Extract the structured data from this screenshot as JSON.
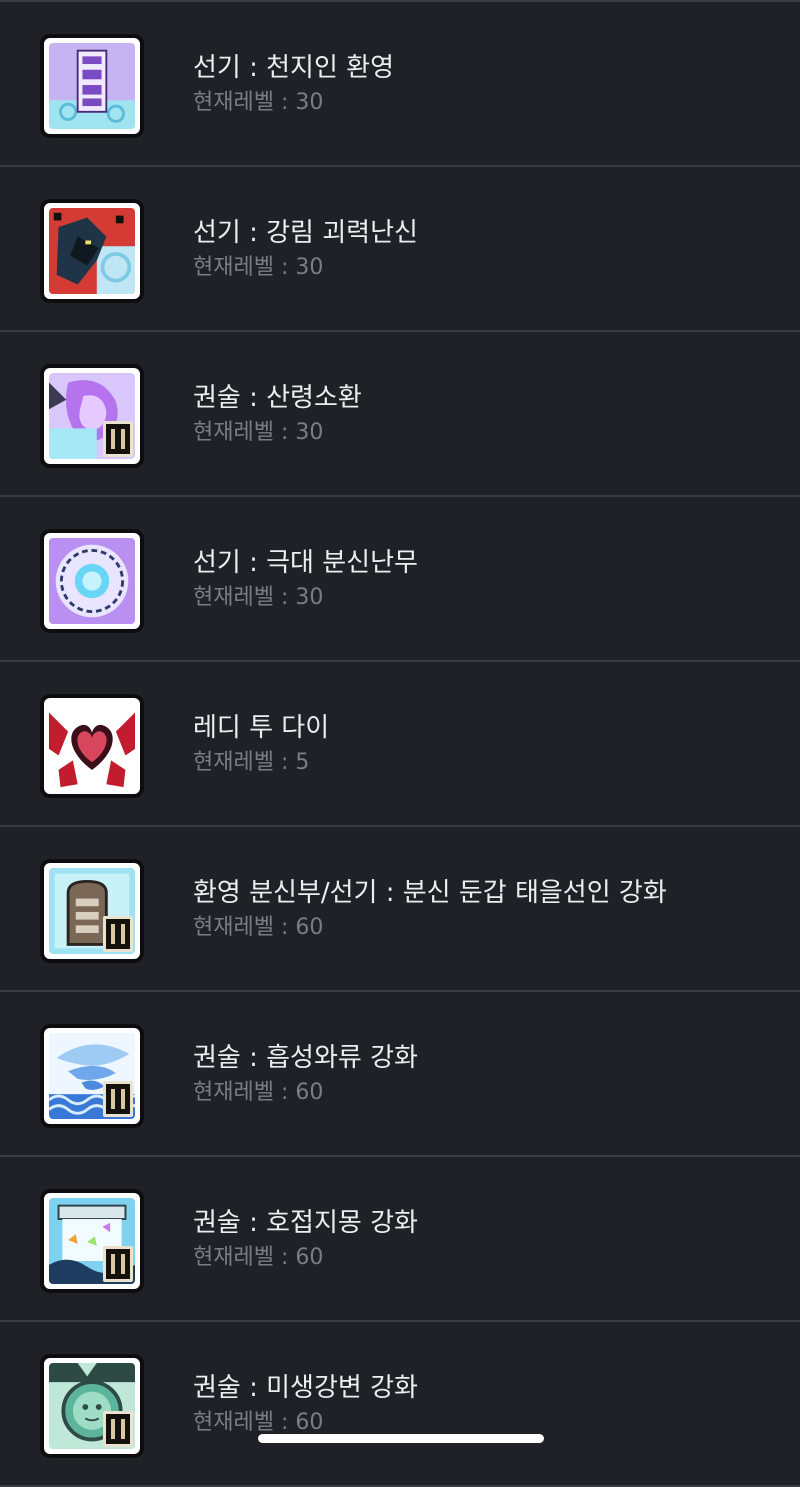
{
  "level_prefix": "현재레벨 : ",
  "skills": [
    {
      "name": "선기 : 천지인 환영",
      "level": "현재레벨 : 30",
      "icon": "cheonjiin-illusion-icon",
      "colors": [
        "#b99cf0",
        "#8fe6f2",
        "#ffffff"
      ]
    },
    {
      "name": "선기 : 강림 괴력난신",
      "level": "현재레벨 : 30",
      "icon": "descent-strength-god-icon",
      "colors": [
        "#c42a2a",
        "#1f3446",
        "#9fdcf0"
      ]
    },
    {
      "name": "권술 : 산령소환",
      "level": "현재레벨 : 30",
      "icon": "mountain-spirit-summon-icon",
      "colors": [
        "#b77ef0",
        "#a6e8f5",
        "#ffffff"
      ]
    },
    {
      "name": "선기 : 극대 분신난무",
      "level": "현재레벨 : 30",
      "icon": "clone-rampage-icon",
      "colors": [
        "#b78cf2",
        "#5fd3f5",
        "#eef4ff"
      ]
    },
    {
      "name": "레디 투 다이",
      "level": "현재레벨 : 5",
      "icon": "ready-to-die-heart-icon",
      "colors": [
        "#c21d2e",
        "#3a0f1a",
        "#ffffff"
      ]
    },
    {
      "name": "환영 분신부/선기 : 분신 둔갑 태을선인 강화",
      "level": "현재레벨 : 60",
      "icon": "tombstone-clone-icon",
      "colors": [
        "#7ed6ec",
        "#6b5a4a",
        "#d8f4fb"
      ]
    },
    {
      "name": "권술 : 흡성와류 강화",
      "level": "현재레벨 : 60",
      "icon": "vortex-icon",
      "colors": [
        "#8cc7f2",
        "#2f6fd0",
        "#ffffff"
      ]
    },
    {
      "name": "권술 : 호접지몽 강화",
      "level": "현재레벨 : 60",
      "icon": "butterfly-dream-icon",
      "colors": [
        "#58b8e8",
        "#f2a23a",
        "#9be36c"
      ]
    },
    {
      "name": "권술 : 미생강변 강화",
      "level": "현재레벨 : 60",
      "icon": "riverside-mirror-icon",
      "colors": [
        "#6fc9b2",
        "#2d4a44",
        "#bfe8d8"
      ]
    }
  ]
}
